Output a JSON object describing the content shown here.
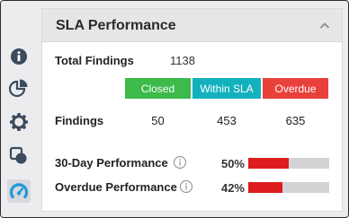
{
  "sidebar": {
    "items": [
      {
        "name": "info",
        "icon": "info-icon"
      },
      {
        "name": "analytics",
        "icon": "pie-chart-icon"
      },
      {
        "name": "settings",
        "icon": "gear-icon"
      },
      {
        "name": "layers",
        "icon": "overlap-icon"
      },
      {
        "name": "dashboard",
        "icon": "gauge-icon",
        "active": true
      }
    ]
  },
  "card": {
    "title": "SLA Performance",
    "collapse_icon": "chevron-up-icon",
    "total_findings_label": "Total Findings",
    "total_findings_value": "1138",
    "columns": [
      {
        "label": "Closed",
        "color": "#3cba4b"
      },
      {
        "label": "Within SLA",
        "color": "#12b1bd"
      },
      {
        "label": "Overdue",
        "color": "#e8413c"
      }
    ],
    "findings_label": "Findings",
    "findings_values": [
      "50",
      "453",
      "635"
    ],
    "metrics": [
      {
        "label": "30-Day Performance",
        "percent_text": "50%",
        "fraction": 0.5,
        "color": "#dd1d1d"
      },
      {
        "label": "Overdue Performance",
        "percent_text": "42%",
        "fraction": 0.42,
        "color": "#dd1d1d"
      }
    ]
  },
  "colors": {
    "sidebar_icon": "#3b4a5c",
    "active_icon": "#1e9bd7"
  }
}
